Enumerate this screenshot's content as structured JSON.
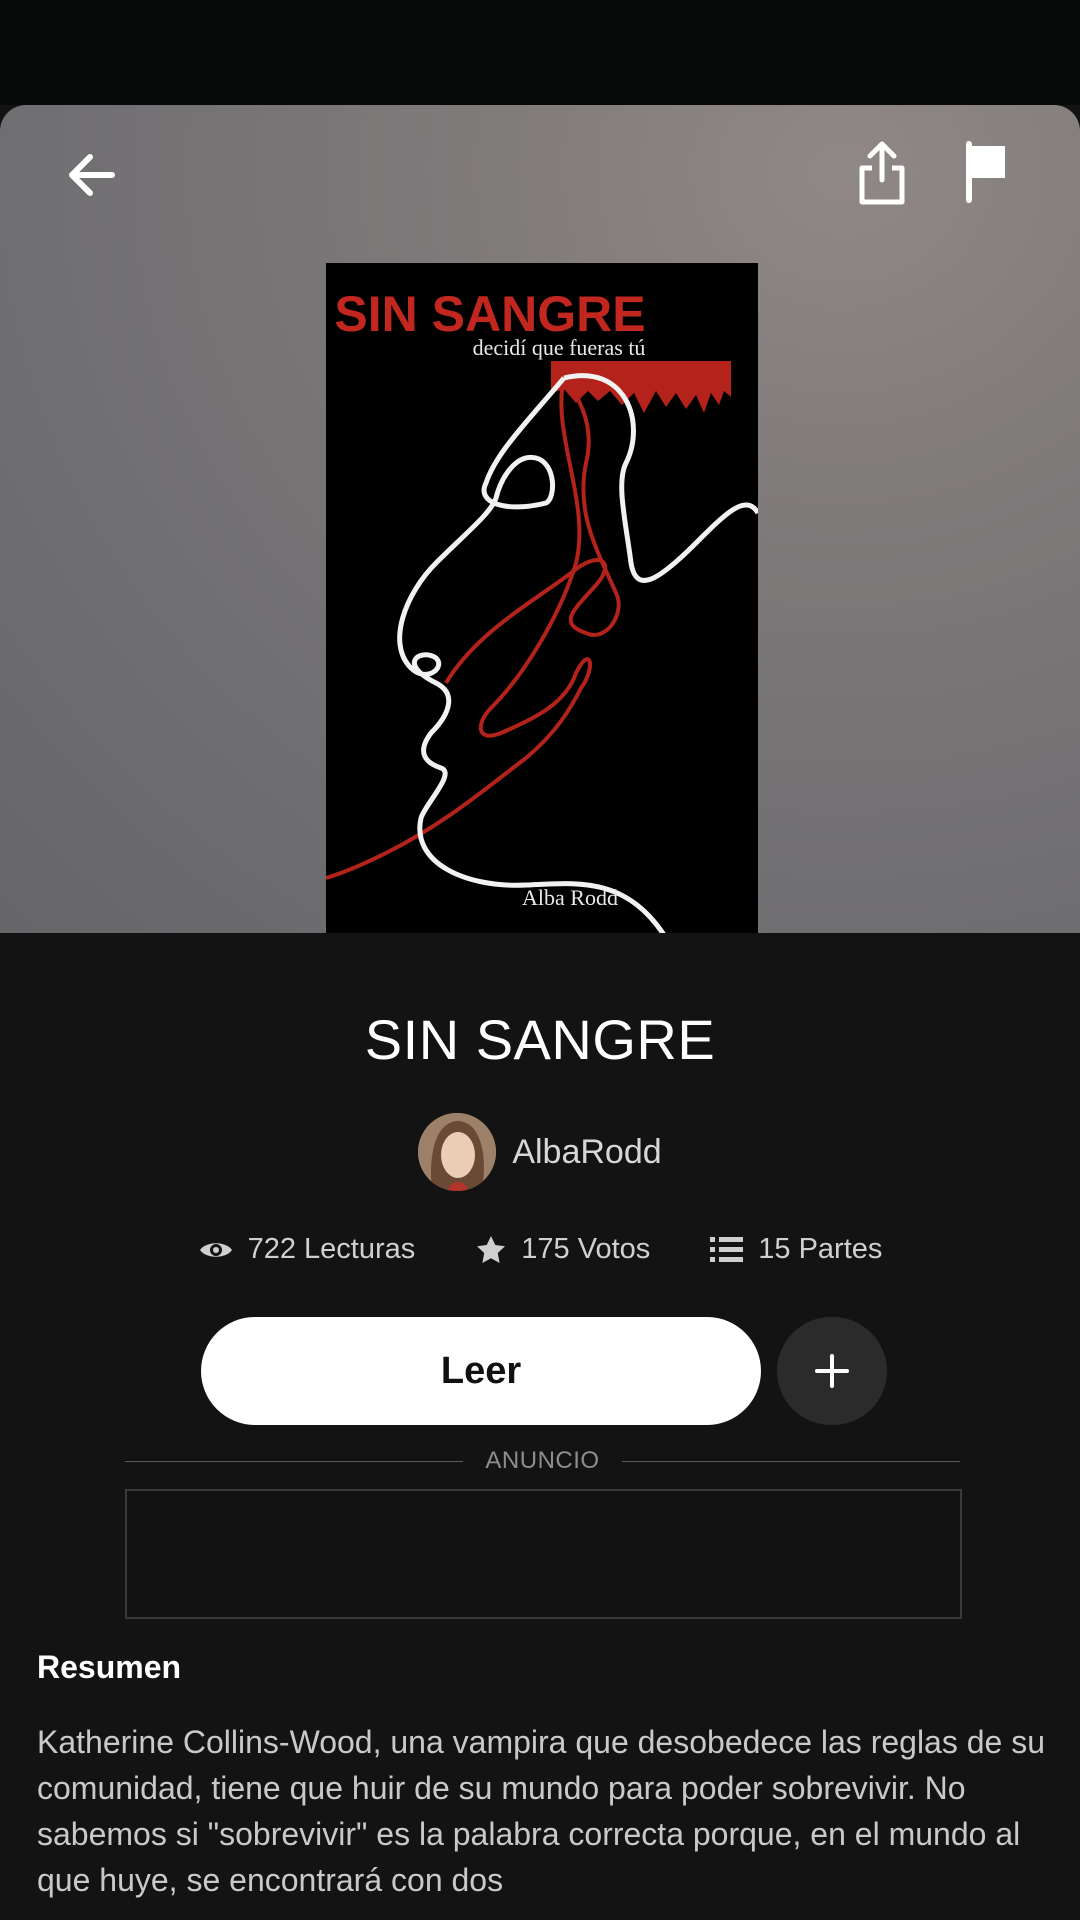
{
  "header": {
    "back_icon": "arrow-left-icon",
    "share_icon": "share-icon",
    "report_icon": "flag-icon"
  },
  "cover": {
    "title": "SIN SANGRE",
    "subtitle": "decidí que fueras tú",
    "author": "Alba Rodd"
  },
  "book": {
    "title": "SIN SANGRE",
    "author": "AlbaRodd"
  },
  "stats": {
    "reads": "722 Lecturas",
    "votes": "175 Votos",
    "parts": "15 Partes"
  },
  "actions": {
    "read_label": "Leer",
    "add_icon": "plus-icon"
  },
  "ad": {
    "label": "ANUNCIO"
  },
  "summary": {
    "heading": "Resumen",
    "text": "Katherine Collins-Wood, una vampira que desobedece las reglas de su comunidad, tiene que huir de su mundo para poder sobrevivir. No sabemos si \"sobrevivir\" es la palabra correcta porque, en el mundo al que huye, se encontrará con dos"
  },
  "colors": {
    "background": "#131313",
    "accent_red": "#c1271f",
    "button_white": "#ffffff",
    "add_button": "#2b2b2b"
  }
}
